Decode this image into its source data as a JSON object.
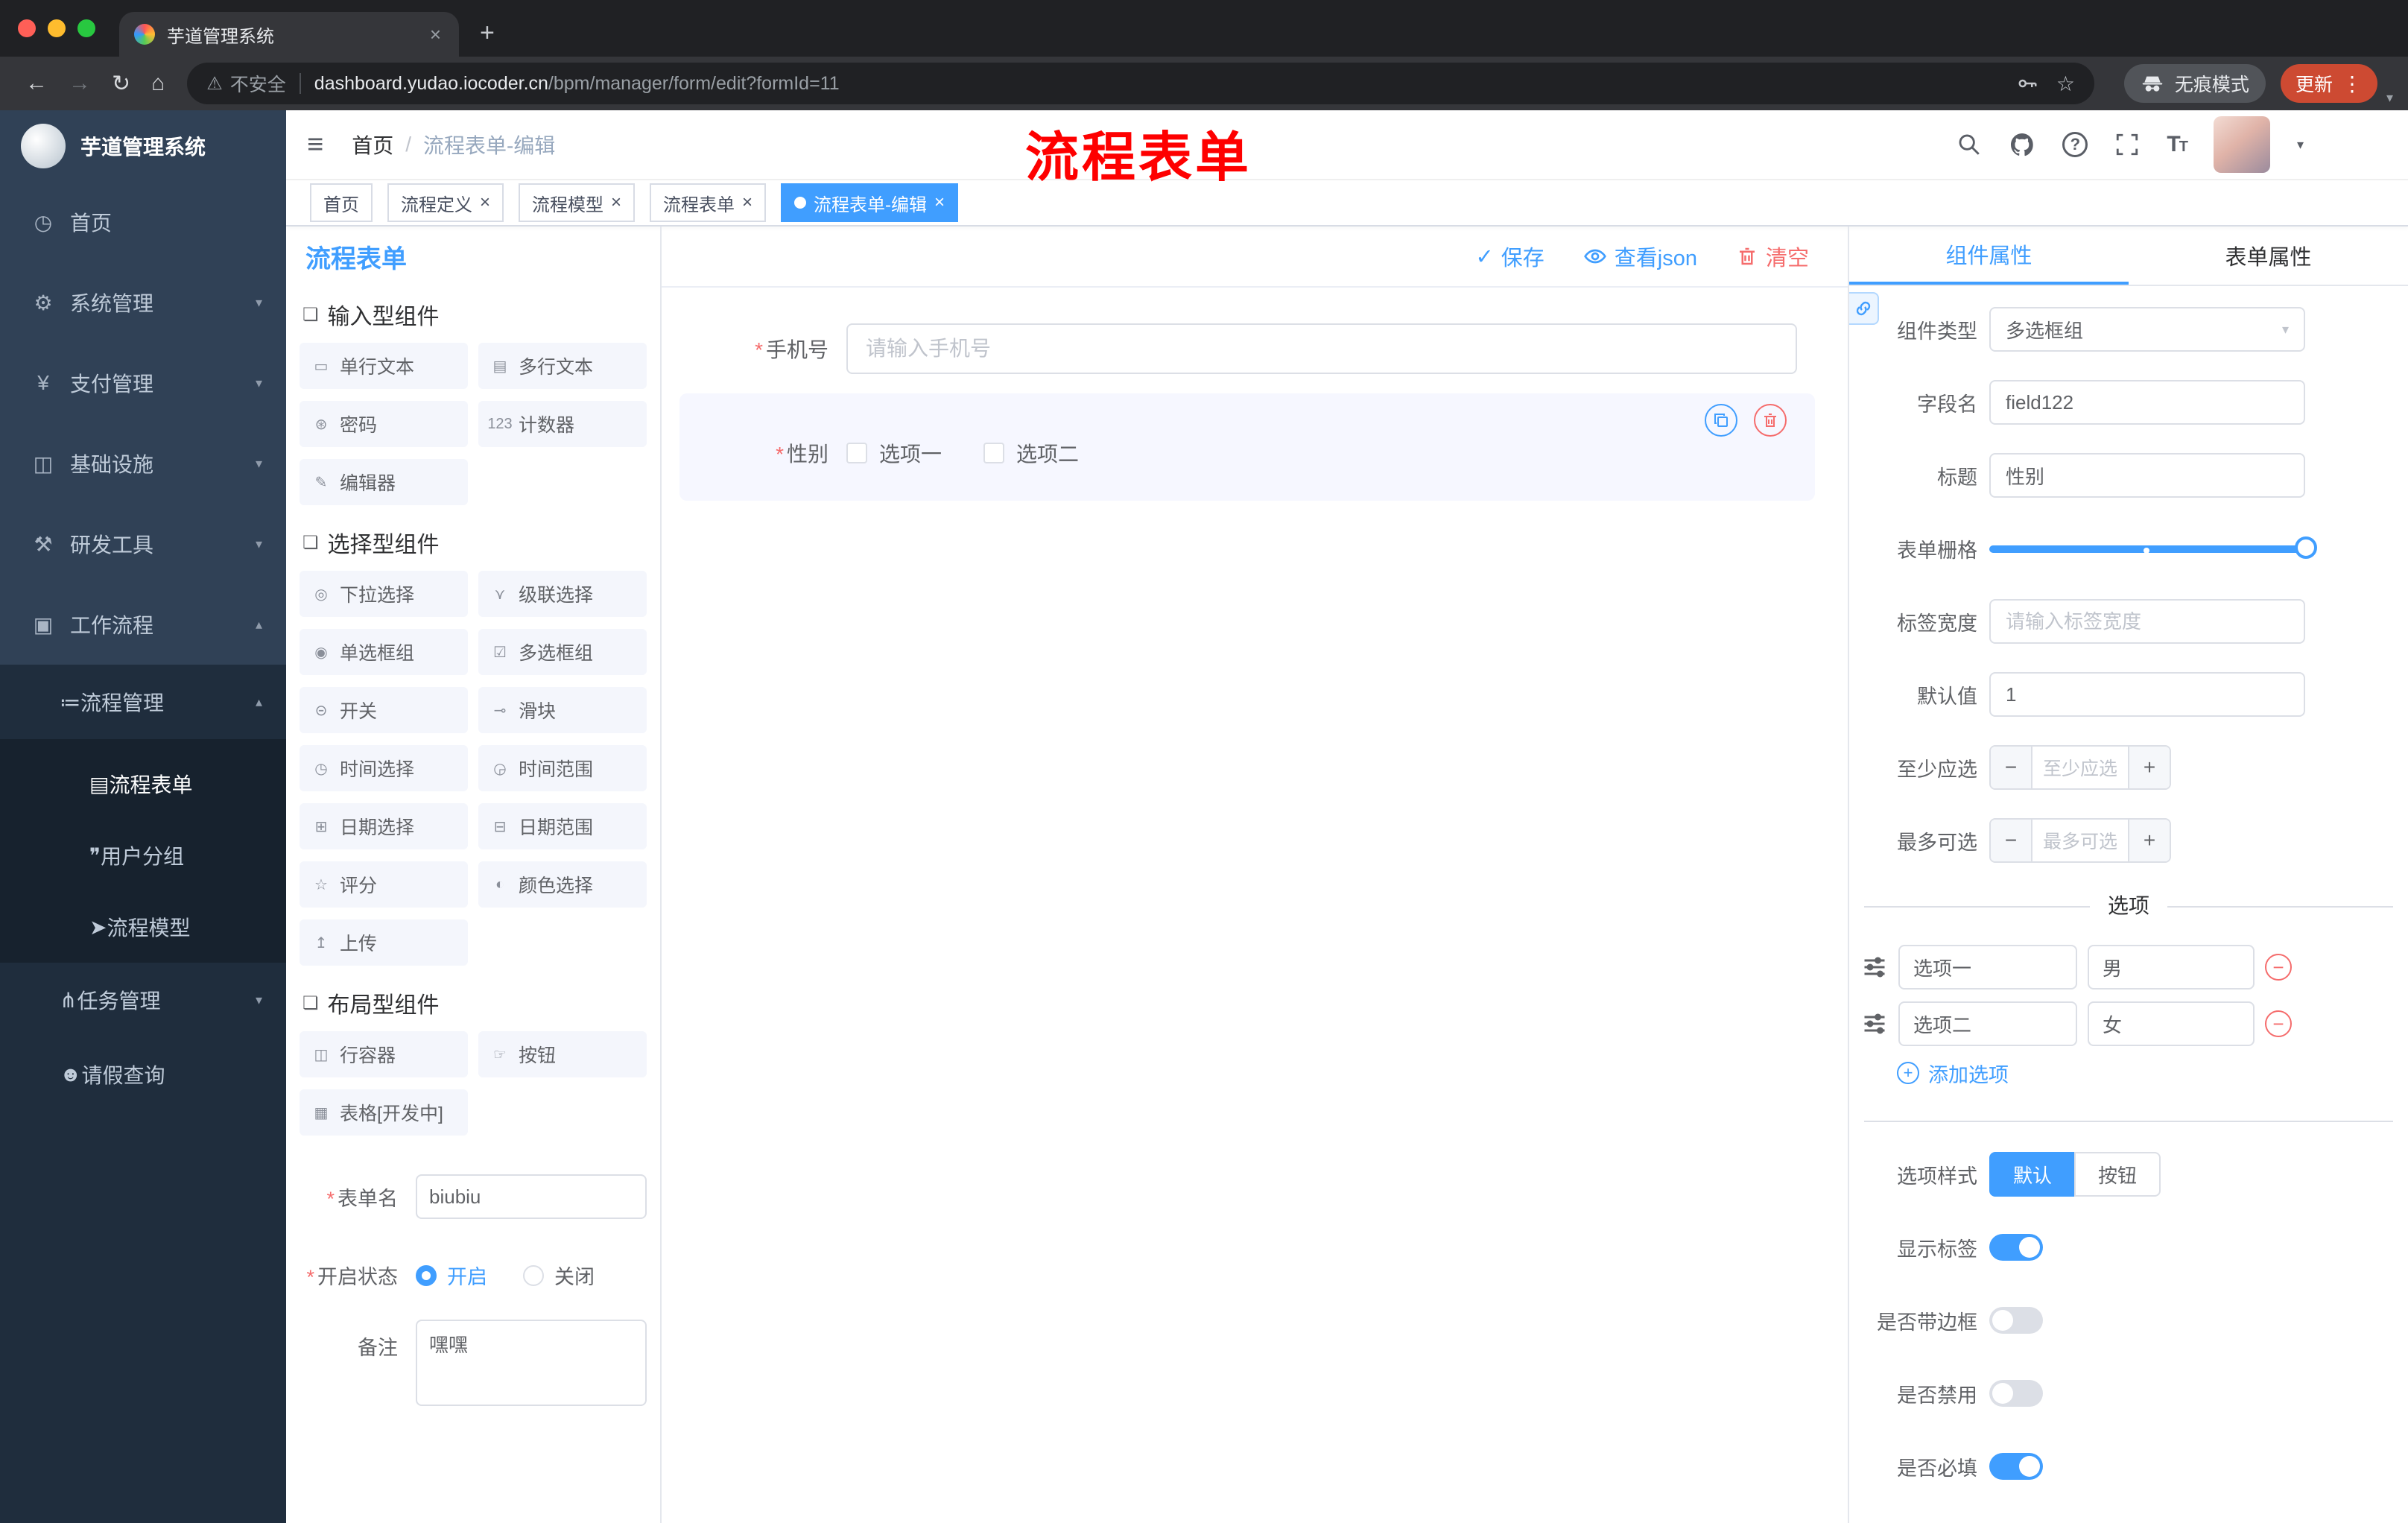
{
  "colors": {
    "accent": "#409eff",
    "danger": "#f56c6c",
    "sidebar_bg": "#304156",
    "submenu_bg": "#1f2d3d",
    "tag_active": "#409eff",
    "annotation": "#fe0000"
  },
  "misc": {
    "required": "*"
  },
  "icons": {
    "hamburger": "≡",
    "chevron_down": "▾",
    "chevron_up": "▴",
    "caret_down": "▾",
    "back": "←",
    "forward": "→",
    "reload": "↻",
    "home": "⌂",
    "plus": "+",
    "close": "×",
    "menu_dots": "⋮",
    "warning": "⚠",
    "star": "☆",
    "check": "✓",
    "minus": "−",
    "question": "?",
    "dash_home": "◷",
    "gear": "⚙",
    "yen": "¥",
    "infra": "◫",
    "tools": "⚒",
    "workflow": "▣",
    "process": "≔",
    "doc": "▤",
    "chat": "❞",
    "send": "➤",
    "tree": "⋔",
    "person": "☻",
    "group": "❏"
  },
  "browser": {
    "tab_title": "芋道管理系统",
    "not_secure": "不安全",
    "url_domain": "dashboard.yudao.iocoder.cn",
    "url_path": "/bpm/manager/form/edit?formId=11",
    "incognito": "无痕模式",
    "update": "更新"
  },
  "annotation": {
    "text": "流程表单"
  },
  "sidebar": {
    "logo_title": "芋道管理系统",
    "items": [
      {
        "label": "首页"
      },
      {
        "label": "系统管理"
      },
      {
        "label": "支付管理"
      },
      {
        "label": "基础设施"
      },
      {
        "label": "研发工具"
      },
      {
        "label": "工作流程"
      }
    ],
    "sub": {
      "process": "流程管理",
      "form": "流程表单",
      "users": "用户分组",
      "model": "流程模型",
      "tasks": "任务管理",
      "leave": "请假查询"
    }
  },
  "header": {
    "breadcrumb_home": "首页",
    "breadcrumb_sep": "/",
    "breadcrumb_current": "流程表单-编辑"
  },
  "tags": [
    {
      "label": "首页",
      "active": false
    },
    {
      "label": "流程定义",
      "active": false
    },
    {
      "label": "流程模型",
      "active": false
    },
    {
      "label": "流程表单",
      "active": false
    },
    {
      "label": "流程表单-编辑",
      "active": true
    }
  ],
  "designer": {
    "title": "流程表单",
    "save": "保存",
    "view_json": "查看json",
    "clear": "清空"
  },
  "library": {
    "groups": [
      {
        "title": "输入型组件",
        "items": [
          {
            "label": "单行文本",
            "glyph": "▭"
          },
          {
            "label": "多行文本",
            "glyph": "▤"
          },
          {
            "label": "密码",
            "glyph": "⊛"
          },
          {
            "label": "计数器",
            "glyph": "123"
          },
          {
            "label": "编辑器",
            "glyph": "✎"
          }
        ]
      },
      {
        "title": "选择型组件",
        "items": [
          {
            "label": "下拉选择",
            "glyph": "◎"
          },
          {
            "label": "级联选择",
            "glyph": "⋎"
          },
          {
            "label": "单选框组",
            "glyph": "◉"
          },
          {
            "label": "多选框组",
            "glyph": "☑"
          },
          {
            "label": "开关",
            "glyph": "⊝"
          },
          {
            "label": "滑块",
            "glyph": "⊸"
          },
          {
            "label": "时间选择",
            "glyph": "◷"
          },
          {
            "label": "时间范围",
            "glyph": "◶"
          },
          {
            "label": "日期选择",
            "glyph": "⊞"
          },
          {
            "label": "日期范围",
            "glyph": "⊟"
          },
          {
            "label": "评分",
            "glyph": "☆"
          },
          {
            "label": "颜色选择",
            "glyph": "◐"
          },
          {
            "label": "上传",
            "glyph": "↥"
          }
        ]
      },
      {
        "title": "布局型组件",
        "items": [
          {
            "label": "行容器",
            "glyph": "◫"
          },
          {
            "label": "按钮",
            "glyph": "☞"
          },
          {
            "label": "表格[开发中]",
            "glyph": "▦"
          }
        ]
      }
    ],
    "form": {
      "name_label": "表单名",
      "name_value": "biubiu",
      "status_label": "开启状态",
      "status_on": "开启",
      "status_off": "关闭",
      "remark_label": "备注",
      "remark_value": "嘿嘿"
    }
  },
  "canvas": {
    "phone_label": "手机号",
    "phone_placeholder": "请输入手机号",
    "gender_label": "性别",
    "gender_opt1": "选项一",
    "gender_opt2": "选项二"
  },
  "props": {
    "tab_component": "组件属性",
    "tab_form": "表单属性",
    "type_label": "组件类型",
    "type_value": "多选框组",
    "field_label": "字段名",
    "field_value": "field122",
    "title_label": "标题",
    "title_value": "性别",
    "grid_label": "表单栅格",
    "width_label": "标签宽度",
    "width_placeholder": "请输入标签宽度",
    "default_label": "默认值",
    "default_value": "1",
    "min_label": "至少应选",
    "min_placeholder": "至少应选",
    "max_label": "最多可选",
    "max_placeholder": "最多可选",
    "options_divider": "选项",
    "options": [
      {
        "label": "选项一",
        "value": "男"
      },
      {
        "label": "选项二",
        "value": "女"
      }
    ],
    "add_option": "添加选项",
    "style_label": "选项样式",
    "style_default": "默认",
    "style_button": "按钮",
    "switches": [
      {
        "label": "显示标签",
        "on": true
      },
      {
        "label": "是否带边框",
        "on": false
      },
      {
        "label": "是否禁用",
        "on": false
      },
      {
        "label": "是否必填",
        "on": true
      }
    ]
  }
}
